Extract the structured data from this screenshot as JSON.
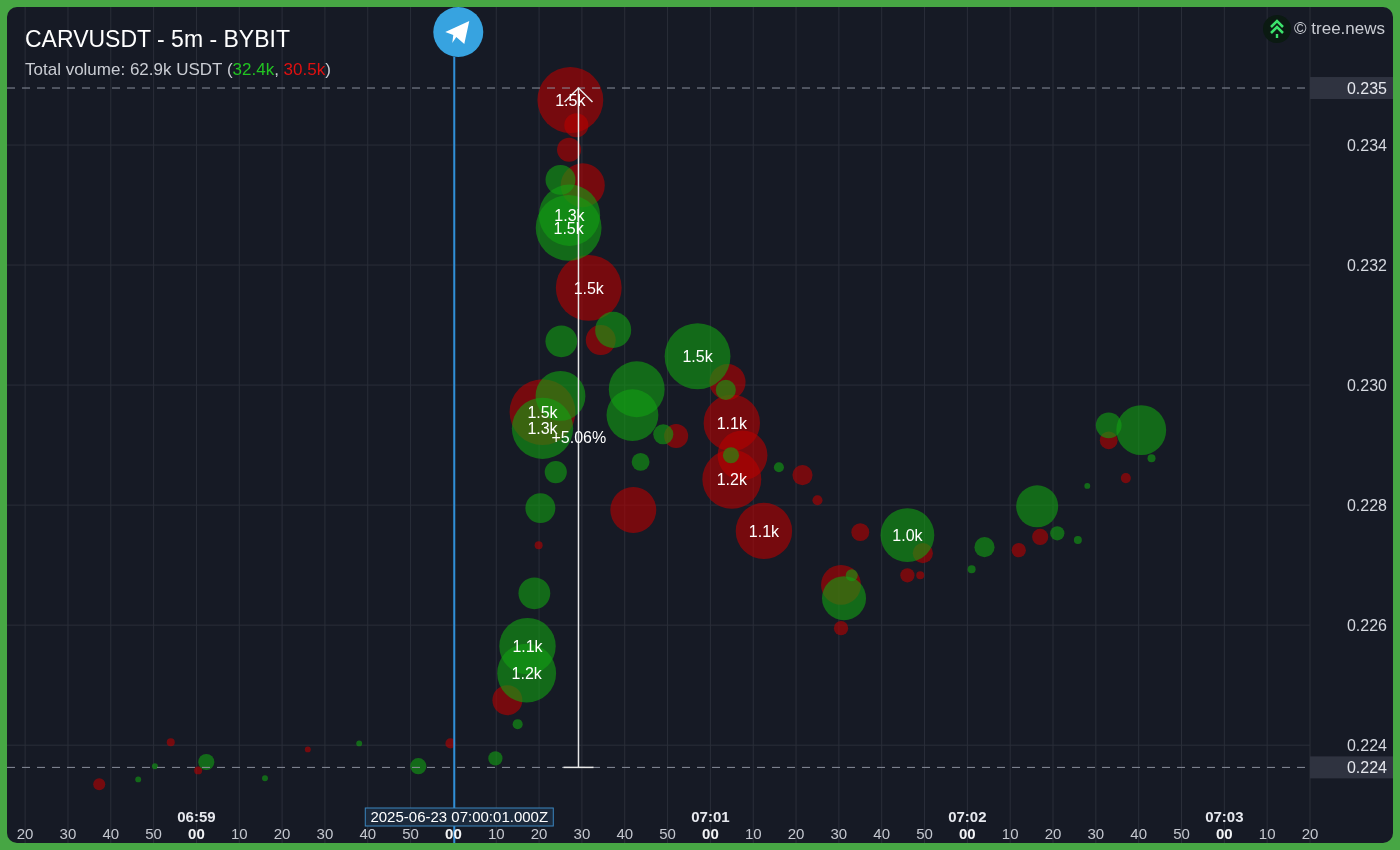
{
  "header": {
    "title": "CARVUSDT - 5m - BYBIT",
    "volume": {
      "prefix": "Total volume: 62.9k USDT (",
      "buy": "32.4k",
      "separator": ", ",
      "sell": "30.5k",
      "suffix": ")"
    }
  },
  "brand": {
    "text": "© tree.news"
  },
  "price_axis": {
    "labels": [
      "0.234",
      "0.232",
      "0.230",
      "0.228",
      "0.226",
      "0.224"
    ],
    "tags": [
      "0.235",
      "0.224"
    ]
  },
  "time_axis": {
    "labels": [
      "20",
      "30",
      "40",
      "50",
      "00",
      "10",
      "20",
      "30",
      "40",
      "50",
      "00",
      "10",
      "20",
      "30",
      "40",
      "50",
      "00",
      "10",
      "20",
      "30",
      "40",
      "50",
      "00",
      "10",
      "20",
      "30",
      "40",
      "50",
      "00",
      "10",
      "20"
    ],
    "minute_labels": [
      "06:59",
      "07:01",
      "07:02",
      "07:03"
    ],
    "crosshair_time": "2025-06-23 07:00:01.000Z"
  },
  "bubble_labels": [
    "1.5k",
    "1.3k",
    "1.5k",
    "1.5k",
    "1.5k",
    "1.5k",
    "1.3k",
    "1.1k",
    "1.2k",
    "1.1k",
    "1.0k",
    "1.1k",
    "1.2k"
  ],
  "change_label": "+5.06%"
}
